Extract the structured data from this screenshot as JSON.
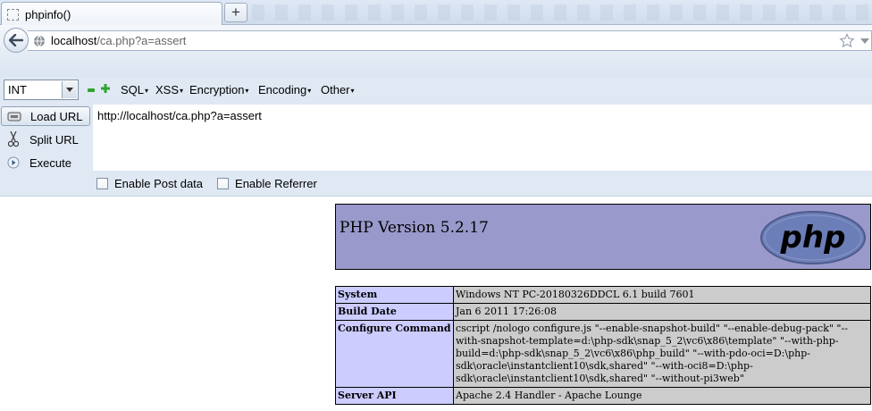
{
  "browser": {
    "tab_title": "phpinfo()",
    "new_tab_label": "+",
    "url_host": "localhost",
    "url_path": "/ca.php?a=assert"
  },
  "hackbar": {
    "select_value": "INT",
    "menu": {
      "sql": "SQL",
      "xss": "XSS",
      "encryption": "Encryption",
      "encoding": "Encoding",
      "other": "Other"
    },
    "caret": "▾",
    "buttons": {
      "load_url": "Load URL",
      "split_url": "Split URL",
      "execute": "Execute"
    },
    "textarea_value": "http://localhost/ca.php?a=assert",
    "enable_post": "Enable Post data",
    "enable_referrer": "Enable Referrer"
  },
  "phpinfo": {
    "version_title": "PHP Version 5.2.17",
    "logo_text": "php",
    "rows": [
      {
        "key": "System",
        "value": "Windows NT PC-20180326DDCL 6.1 build 7601"
      },
      {
        "key": "Build Date",
        "value": "Jan 6 2011 17:26:08"
      },
      {
        "key": "Configure Command",
        "value": "cscript /nologo configure.js \"--enable-snapshot-build\" \"--enable-debug-pack\" \"--with-snapshot-template=d:\\php-sdk\\snap_5_2\\vc6\\x86\\template\" \"--with-php-build=d:\\php-sdk\\snap_5_2\\vc6\\x86\\php_build\" \"--with-pdo-oci=D:\\php-sdk\\oracle\\instantclient10\\sdk,shared\" \"--with-oci8=D:\\php-sdk\\oracle\\instantclient10\\sdk,shared\" \"--without-pi3web\""
      },
      {
        "key": "Server API",
        "value": "Apache 2.4 Handler - Apache Lounge"
      }
    ]
  },
  "colors": {
    "php_header_bg": "#9999cc",
    "php_key_bg": "#ccccff",
    "php_value_bg": "#cccccc"
  }
}
